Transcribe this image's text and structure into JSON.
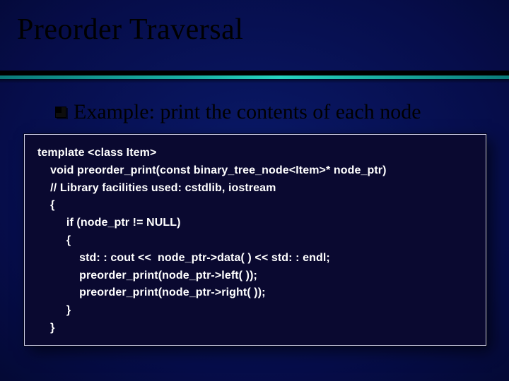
{
  "slide": {
    "title": "Preorder Traversal",
    "subhead_label": "Example:",
    "subhead_rest": " print the contents of each node"
  },
  "code": {
    "l1": "template <class Item>",
    "l2": "    void preorder_print(const binary_tree_node<Item>* node_ptr)",
    "l3": "    // Library facilities used: cstdlib, iostream",
    "l4": "    {",
    "l5": "         if (node_ptr != NULL)",
    "l6": "         {",
    "l7": "             std: : cout <<  node_ptr->data( ) << std: : endl;",
    "l8": "             preorder_print(node_ptr->left( ));",
    "l9": "             preorder_print(node_ptr->right( ));",
    "l10": "         }",
    "l11": "    }"
  }
}
